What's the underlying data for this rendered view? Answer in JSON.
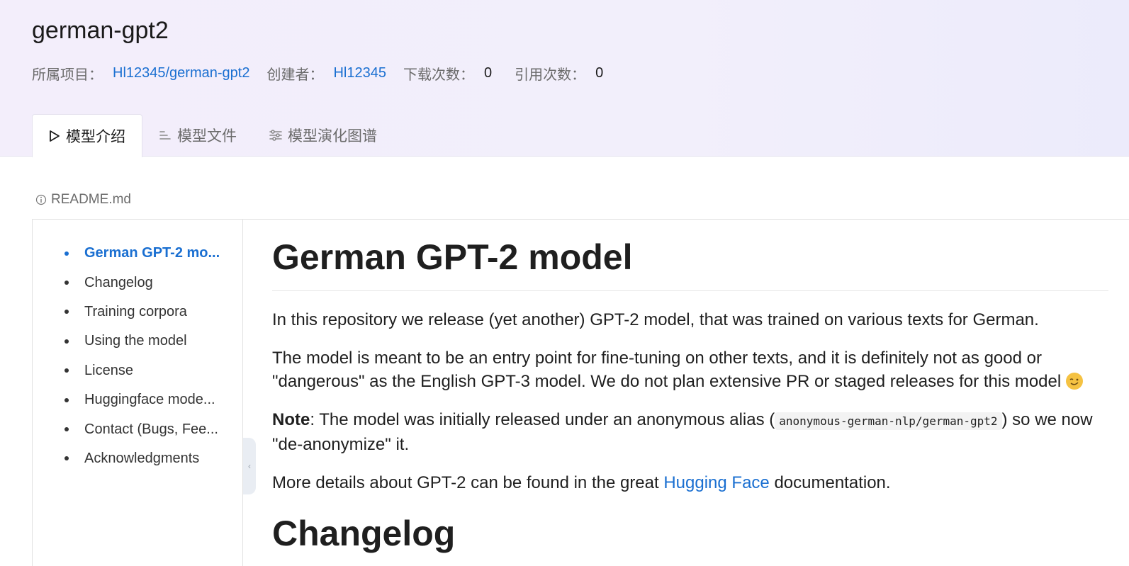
{
  "header": {
    "title": "german-gpt2",
    "project_label": "所属项目：",
    "project_link": "Hl12345/german-gpt2",
    "creator_label": "创建者：",
    "creator_link": "Hl12345",
    "downloads_label": "下载次数：",
    "downloads_value": "0",
    "citations_label": "引用次数：",
    "citations_value": "0"
  },
  "tabs": [
    {
      "label": "模型介绍",
      "icon": "play-icon",
      "active": true
    },
    {
      "label": "模型文件",
      "icon": "list-icon",
      "active": false
    },
    {
      "label": "模型演化图谱",
      "icon": "sliders-icon",
      "active": false
    }
  ],
  "readme": {
    "label": "README.md",
    "icon": "info-icon"
  },
  "toc": {
    "items": [
      {
        "label": "German GPT-2 mo...",
        "active": true
      },
      {
        "label": "Changelog"
      },
      {
        "label": "Training corpora"
      },
      {
        "label": "Using the model"
      },
      {
        "label": "License"
      },
      {
        "label": "Huggingface mode..."
      },
      {
        "label": "Contact (Bugs, Fee..."
      },
      {
        "label": "Acknowledgments"
      }
    ]
  },
  "content": {
    "h1": "German GPT-2 model",
    "p1": "In this repository we release (yet another) GPT-2 model, that was trained on various texts for German.",
    "p2": "The model is meant to be an entry point for fine-tuning on other texts, and it is definitely not as good or \"dangerous\" as the English GPT-3 model. We do not plan extensive PR or staged releases for this model",
    "p2_emoji": "wink-emoji-icon",
    "p3_bold": "Note",
    "p3_a": ": The model was initially released under an anonymous alias (",
    "p3_code": "anonymous-german-nlp/german-gpt2",
    "p3_b": ") so we now \"de-anonymize\" it.",
    "p4_a": "More details about GPT-2 can be found in the great ",
    "p4_link": "Hugging Face",
    "p4_b": " documentation.",
    "h2": "Changelog"
  },
  "colors": {
    "accent": "#1a6fd1",
    "header_bg": "#f3eefb"
  }
}
